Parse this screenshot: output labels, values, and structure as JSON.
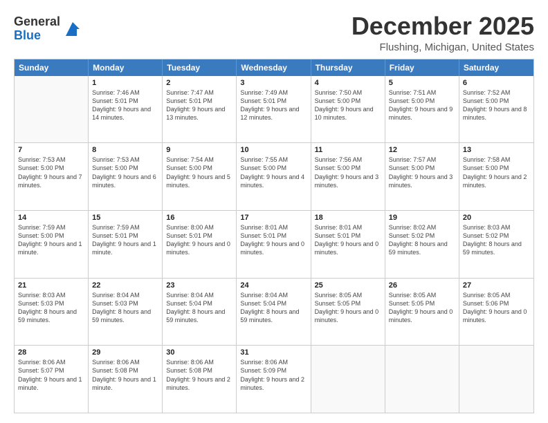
{
  "logo": {
    "general": "General",
    "blue": "Blue"
  },
  "title": "December 2025",
  "location": "Flushing, Michigan, United States",
  "days_of_week": [
    "Sunday",
    "Monday",
    "Tuesday",
    "Wednesday",
    "Thursday",
    "Friday",
    "Saturday"
  ],
  "weeks": [
    [
      {
        "day": "",
        "empty": true
      },
      {
        "day": "1",
        "sunrise": "7:46 AM",
        "sunset": "5:01 PM",
        "daylight": "9 hours and 14 minutes."
      },
      {
        "day": "2",
        "sunrise": "7:47 AM",
        "sunset": "5:01 PM",
        "daylight": "9 hours and 13 minutes."
      },
      {
        "day": "3",
        "sunrise": "7:49 AM",
        "sunset": "5:01 PM",
        "daylight": "9 hours and 12 minutes."
      },
      {
        "day": "4",
        "sunrise": "7:50 AM",
        "sunset": "5:00 PM",
        "daylight": "9 hours and 10 minutes."
      },
      {
        "day": "5",
        "sunrise": "7:51 AM",
        "sunset": "5:00 PM",
        "daylight": "9 hours and 9 minutes."
      },
      {
        "day": "6",
        "sunrise": "7:52 AM",
        "sunset": "5:00 PM",
        "daylight": "9 hours and 8 minutes."
      }
    ],
    [
      {
        "day": "7",
        "sunrise": "7:53 AM",
        "sunset": "5:00 PM",
        "daylight": "9 hours and 7 minutes."
      },
      {
        "day": "8",
        "sunrise": "7:53 AM",
        "sunset": "5:00 PM",
        "daylight": "9 hours and 6 minutes."
      },
      {
        "day": "9",
        "sunrise": "7:54 AM",
        "sunset": "5:00 PM",
        "daylight": "9 hours and 5 minutes."
      },
      {
        "day": "10",
        "sunrise": "7:55 AM",
        "sunset": "5:00 PM",
        "daylight": "9 hours and 4 minutes."
      },
      {
        "day": "11",
        "sunrise": "7:56 AM",
        "sunset": "5:00 PM",
        "daylight": "9 hours and 3 minutes."
      },
      {
        "day": "12",
        "sunrise": "7:57 AM",
        "sunset": "5:00 PM",
        "daylight": "9 hours and 3 minutes."
      },
      {
        "day": "13",
        "sunrise": "7:58 AM",
        "sunset": "5:00 PM",
        "daylight": "9 hours and 2 minutes."
      }
    ],
    [
      {
        "day": "14",
        "sunrise": "7:59 AM",
        "sunset": "5:00 PM",
        "daylight": "9 hours and 1 minute."
      },
      {
        "day": "15",
        "sunrise": "7:59 AM",
        "sunset": "5:01 PM",
        "daylight": "9 hours and 1 minute."
      },
      {
        "day": "16",
        "sunrise": "8:00 AM",
        "sunset": "5:01 PM",
        "daylight": "9 hours and 0 minutes."
      },
      {
        "day": "17",
        "sunrise": "8:01 AM",
        "sunset": "5:01 PM",
        "daylight": "9 hours and 0 minutes."
      },
      {
        "day": "18",
        "sunrise": "8:01 AM",
        "sunset": "5:01 PM",
        "daylight": "9 hours and 0 minutes."
      },
      {
        "day": "19",
        "sunrise": "8:02 AM",
        "sunset": "5:02 PM",
        "daylight": "8 hours and 59 minutes."
      },
      {
        "day": "20",
        "sunrise": "8:03 AM",
        "sunset": "5:02 PM",
        "daylight": "8 hours and 59 minutes."
      }
    ],
    [
      {
        "day": "21",
        "sunrise": "8:03 AM",
        "sunset": "5:03 PM",
        "daylight": "8 hours and 59 minutes."
      },
      {
        "day": "22",
        "sunrise": "8:04 AM",
        "sunset": "5:03 PM",
        "daylight": "8 hours and 59 minutes."
      },
      {
        "day": "23",
        "sunrise": "8:04 AM",
        "sunset": "5:04 PM",
        "daylight": "8 hours and 59 minutes."
      },
      {
        "day": "24",
        "sunrise": "8:04 AM",
        "sunset": "5:04 PM",
        "daylight": "8 hours and 59 minutes."
      },
      {
        "day": "25",
        "sunrise": "8:05 AM",
        "sunset": "5:05 PM",
        "daylight": "9 hours and 0 minutes."
      },
      {
        "day": "26",
        "sunrise": "8:05 AM",
        "sunset": "5:05 PM",
        "daylight": "9 hours and 0 minutes."
      },
      {
        "day": "27",
        "sunrise": "8:05 AM",
        "sunset": "5:06 PM",
        "daylight": "9 hours and 0 minutes."
      }
    ],
    [
      {
        "day": "28",
        "sunrise": "8:06 AM",
        "sunset": "5:07 PM",
        "daylight": "9 hours and 1 minute."
      },
      {
        "day": "29",
        "sunrise": "8:06 AM",
        "sunset": "5:08 PM",
        "daylight": "9 hours and 1 minute."
      },
      {
        "day": "30",
        "sunrise": "8:06 AM",
        "sunset": "5:08 PM",
        "daylight": "9 hours and 2 minutes."
      },
      {
        "day": "31",
        "sunrise": "8:06 AM",
        "sunset": "5:09 PM",
        "daylight": "9 hours and 2 minutes."
      },
      {
        "day": "",
        "empty": true
      },
      {
        "day": "",
        "empty": true
      },
      {
        "day": "",
        "empty": true
      }
    ]
  ]
}
